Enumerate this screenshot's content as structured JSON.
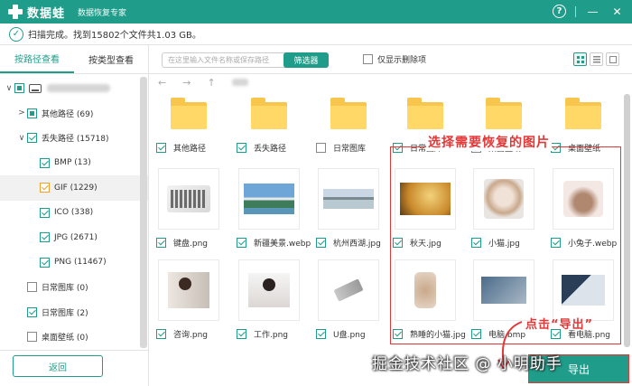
{
  "app": {
    "name": "数据蛙",
    "subtitle": "数据恢复专家"
  },
  "status": {
    "text": "扫描完成。找到15802个文件共1.03 GB。"
  },
  "left_tabs": [
    {
      "label": "按路径查看",
      "active": true
    },
    {
      "label": "按类型查看",
      "active": false
    }
  ],
  "tree": [
    {
      "label": "",
      "level": 0,
      "arrow": "down",
      "check": "partial",
      "drive": true
    },
    {
      "label": "其他路径 (69)",
      "level": 1,
      "arrow": "right",
      "check": "partial"
    },
    {
      "label": "丢失路径 (15718)",
      "level": 1,
      "arrow": "down",
      "check": "checked"
    },
    {
      "label": "BMP (13)",
      "level": 2,
      "arrow": "",
      "check": "checked"
    },
    {
      "label": "GIF (1229)",
      "level": 2,
      "arrow": "",
      "check": "orange",
      "highlight": true
    },
    {
      "label": "ICO (338)",
      "level": 2,
      "arrow": "",
      "check": "checked"
    },
    {
      "label": "JPG (2671)",
      "level": 2,
      "arrow": "",
      "check": "checked"
    },
    {
      "label": "PNG (11467)",
      "level": 2,
      "arrow": "",
      "check": "checked"
    },
    {
      "label": "日常图库 (0)",
      "level": 1,
      "arrow": "",
      "check": "none"
    },
    {
      "label": "日常图库 (2)",
      "level": 1,
      "arrow": "",
      "check": "checked"
    },
    {
      "label": "桌面壁纸 (0)",
      "level": 1,
      "arrow": "",
      "check": "none"
    }
  ],
  "back_label": "返回",
  "toolbar": {
    "search_placeholder": "在这里输入文件名称或保存路径",
    "filter_label": "筛选器",
    "deleted_only_label": "仅显示删除项"
  },
  "nav": {
    "back": "←",
    "forward": "→",
    "up": "↑"
  },
  "files": [
    {
      "name": "其他路径",
      "kind": "folder",
      "check": "checked"
    },
    {
      "name": "丢失路径",
      "kind": "folder",
      "check": "checked"
    },
    {
      "name": "日常图库",
      "kind": "folder",
      "check": "none"
    },
    {
      "name": "日常图库",
      "kind": "folder",
      "check": "checked"
    },
    {
      "name": "桌面壁纸",
      "kind": "folder",
      "check": "none"
    },
    {
      "name": "桌面壁纸",
      "kind": "folder",
      "check": "checked"
    },
    {
      "name": "键盘.png",
      "kind": "keyboard",
      "check": "checked"
    },
    {
      "name": "新疆美景.webp",
      "kind": "xinjiang",
      "check": "checked"
    },
    {
      "name": "杭州西湖.jpg",
      "kind": "westlake",
      "check": "checked"
    },
    {
      "name": "秋天.jpg",
      "kind": "autumn",
      "check": "checked"
    },
    {
      "name": "小猫.jpg",
      "kind": "cat",
      "check": "checked"
    },
    {
      "name": "小兔子.webp",
      "kind": "rabbit",
      "check": "checked"
    },
    {
      "name": "咨询.png",
      "kind": "consult",
      "check": "checked"
    },
    {
      "name": "工作.png",
      "kind": "work",
      "check": "checked"
    },
    {
      "name": "U盘.png",
      "kind": "usb",
      "check": "checked"
    },
    {
      "name": "熟睡的小猫.jpg",
      "kind": "kitten",
      "check": "checked"
    },
    {
      "name": "电脑.bmp",
      "kind": "laptop1",
      "check": "checked"
    },
    {
      "name": "看电脑.png",
      "kind": "laptop2",
      "check": "checked"
    }
  ],
  "annotations": {
    "select_title": "选择需要恢复的图片",
    "click_hint": "点击“导出”"
  },
  "export_label": "导出",
  "watermark": "掘金技术社区 @ 小明助手",
  "colors": {
    "accent": "#1f9d8a",
    "annotation": "#e23838",
    "folder": "#f8c64c"
  }
}
